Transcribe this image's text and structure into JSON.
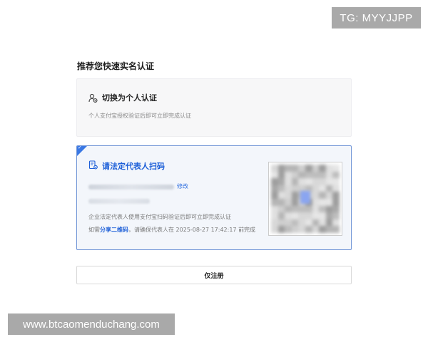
{
  "badge_tg": "TG: MYYJJPP",
  "page_title": "推荐您快速实名认证",
  "personal": {
    "title": "切换为个人认证",
    "description": "个人支付宝授权验证后即可立即完成认证"
  },
  "legal": {
    "title": "请法定代表人扫码",
    "modify_label": "修改",
    "description": "企业法定代表人使用支付宝扫码验证后即可立即完成认证",
    "note_prefix": "如需",
    "note_share": "分享二维码",
    "note_middle": "，请确保代表人在",
    "note_deadline": "2025-08-27 17:42:17",
    "note_suffix": "前完成"
  },
  "register_button": "仅注册",
  "watermark_url": "www.btcaomenduchang.com",
  "colors": {
    "accent_blue": "#1d5fd8",
    "card_border_blue": "#6f94d6",
    "corner_blue": "#3a78e4"
  },
  "icons": {
    "personal": "person-switch-icon",
    "legal": "id-card-scan-icon",
    "corner": "check-corner-icon"
  }
}
